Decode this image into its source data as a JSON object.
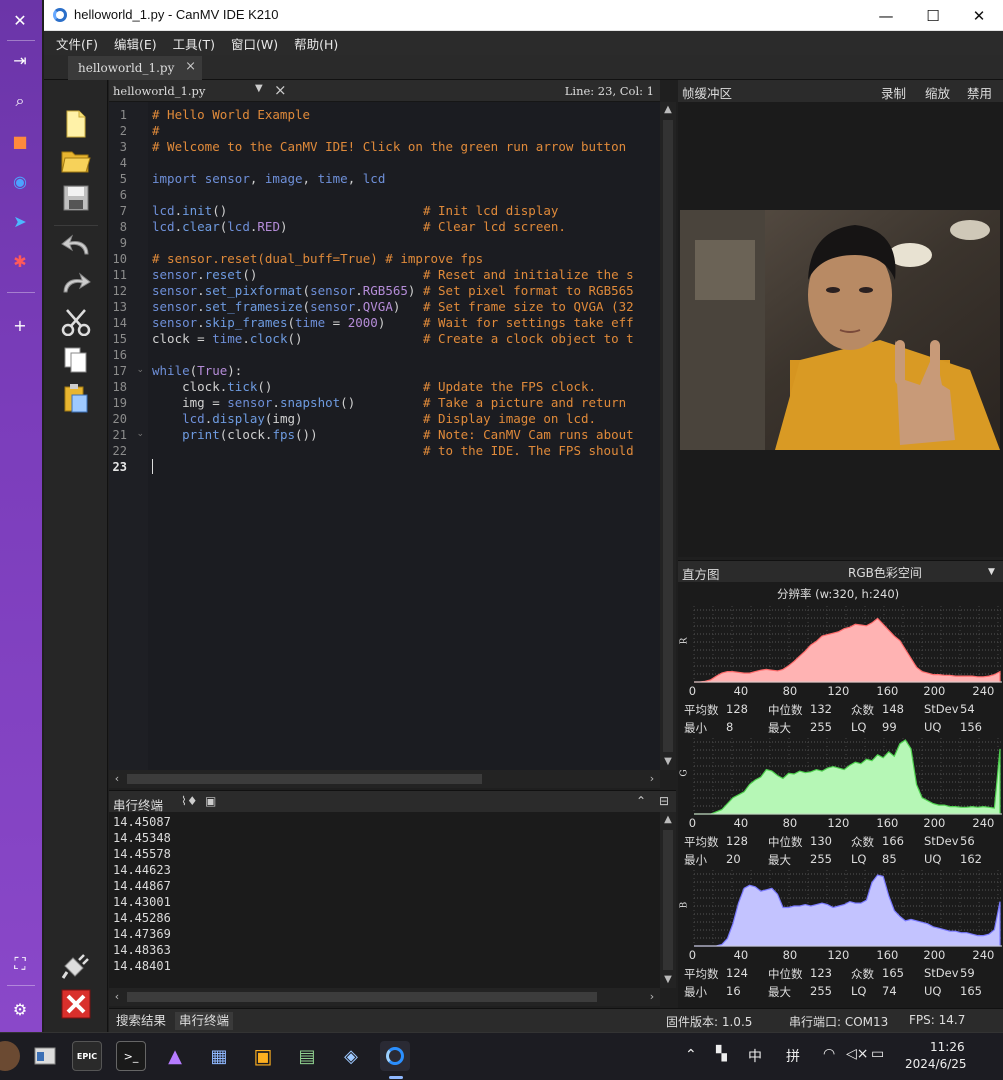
{
  "window": {
    "title": "helloworld_1.py - CanMV IDE K210",
    "minimize": "—",
    "maximize": "☐",
    "close": "✕"
  },
  "menu": [
    "文件(F)",
    "编辑(E)",
    "工具(T)",
    "窗口(W)",
    "帮助(H)"
  ],
  "tab": {
    "label": "helloworld_1.py",
    "close": "×"
  },
  "editor": {
    "file_select": "helloworld_1.py",
    "position": "Line: 23, Col: 1",
    "lines": [
      "# Hello World Example",
      "#",
      "# Welcome to the CanMV IDE! Click on the green run arrow button",
      "",
      "import sensor, image, time, lcd",
      "",
      "lcd.init()                          # Init lcd display",
      "lcd.clear(lcd.RED)                  # Clear lcd screen.",
      "",
      "# sensor.reset(dual_buff=True) # improve fps",
      "sensor.reset()                      # Reset and initialize the s",
      "sensor.set_pixformat(sensor.RGB565) # Set pixel format to RGB565",
      "sensor.set_framesize(sensor.QVGA)   # Set frame size to QVGA (32",
      "sensor.skip_frames(time = 2000)     # Wait for settings take eff",
      "clock = time.clock()                # Create a clock object to t",
      "",
      "while(True):",
      "    clock.tick()                    # Update the FPS clock.",
      "    img = sensor.snapshot()         # Take a picture and return",
      "    lcd.display(img)                # Display image on lcd.",
      "    print(clock.fps())              # Note: CanMV Cam runs about",
      "                                    # to the IDE. The FPS should",
      ""
    ]
  },
  "serial": {
    "title": "串行终端",
    "lines": [
      "14.45087",
      "14.45348",
      "14.45578",
      "14.44623",
      "14.44867",
      "14.43001",
      "14.45286",
      "14.47369",
      "14.48363",
      "14.48401"
    ]
  },
  "framebuffer": {
    "title": "帧缓冲区",
    "record": "录制",
    "zoom": "缩放",
    "disable": "禁用"
  },
  "histogram": {
    "title": "直方图",
    "colorspace": "RGB色彩空间",
    "resolution": "分辨率 (w:320, h:240)",
    "x_ticks": [
      "0",
      "40",
      "80",
      "120",
      "160",
      "200",
      "240"
    ],
    "labels": {
      "mean": "平均数",
      "median": "中位数",
      "mode": "众数",
      "stdev": "StDev",
      "min": "最小",
      "max": "最大",
      "lq": "LQ",
      "uq": "UQ"
    },
    "channels": [
      {
        "name": "R",
        "color": "#ffb3b3",
        "stroke": "#ff6b6b",
        "mean": "128",
        "median": "132",
        "mode": "148",
        "stdev": "54",
        "min": "8",
        "max": "255",
        "lq": "99",
        "uq": "156",
        "profile": [
          0,
          0,
          1,
          3,
          8,
          12,
          14,
          14,
          13,
          12,
          12,
          14,
          16,
          17,
          16,
          15,
          17,
          22,
          28,
          35,
          42,
          50,
          55,
          62,
          64,
          66,
          68,
          72,
          74,
          78,
          77,
          76,
          80,
          86,
          78,
          70,
          62,
          56,
          44,
          32,
          20,
          14,
          12,
          10,
          10,
          9,
          9,
          8,
          8,
          8,
          8,
          7,
          7,
          8,
          10,
          14
        ]
      },
      {
        "name": "G",
        "color": "#b6f7b6",
        "stroke": "#4fd24f",
        "mean": "128",
        "median": "130",
        "mode": "166",
        "stdev": "56",
        "min": "20",
        "max": "255",
        "lq": "85",
        "uq": "162",
        "profile": [
          0,
          0,
          0,
          0,
          3,
          6,
          14,
          22,
          26,
          30,
          40,
          46,
          50,
          60,
          58,
          52,
          48,
          55,
          54,
          58,
          56,
          57,
          60,
          58,
          62,
          64,
          62,
          60,
          66,
          70,
          68,
          74,
          72,
          80,
          76,
          84,
          78,
          95,
          100,
          88,
          40,
          22,
          18,
          14,
          12,
          12,
          10,
          10,
          9,
          9,
          10,
          9,
          10,
          9,
          8,
          88
        ]
      },
      {
        "name": "B",
        "color": "#c3c3ff",
        "stroke": "#7a7aff",
        "mean": "124",
        "median": "123",
        "mode": "165",
        "stdev": "59",
        "min": "16",
        "max": "255",
        "lq": "74",
        "uq": "165",
        "profile": [
          0,
          0,
          0,
          0,
          0,
          2,
          10,
          30,
          58,
          78,
          82,
          80,
          74,
          76,
          78,
          70,
          52,
          52,
          54,
          54,
          56,
          54,
          56,
          58,
          56,
          52,
          54,
          56,
          60,
          58,
          58,
          62,
          86,
          96,
          94,
          68,
          48,
          40,
          34,
          36,
          34,
          32,
          30,
          26,
          24,
          22,
          20,
          20,
          18,
          18,
          16,
          14,
          14,
          16,
          22,
          60
        ]
      }
    ]
  },
  "statusbar": {
    "tab_search": "搜索结果",
    "tab_serial": "串行终端",
    "firmware": "固件版本: 1.0.5",
    "port": "串行端口: COM13",
    "fps": "FPS:  14.7"
  },
  "taskbar": {
    "time": "11:26",
    "date": "2024/6/25",
    "ime_lang": "中",
    "ime_mode": "拼",
    "epic_label": "EPIC"
  }
}
